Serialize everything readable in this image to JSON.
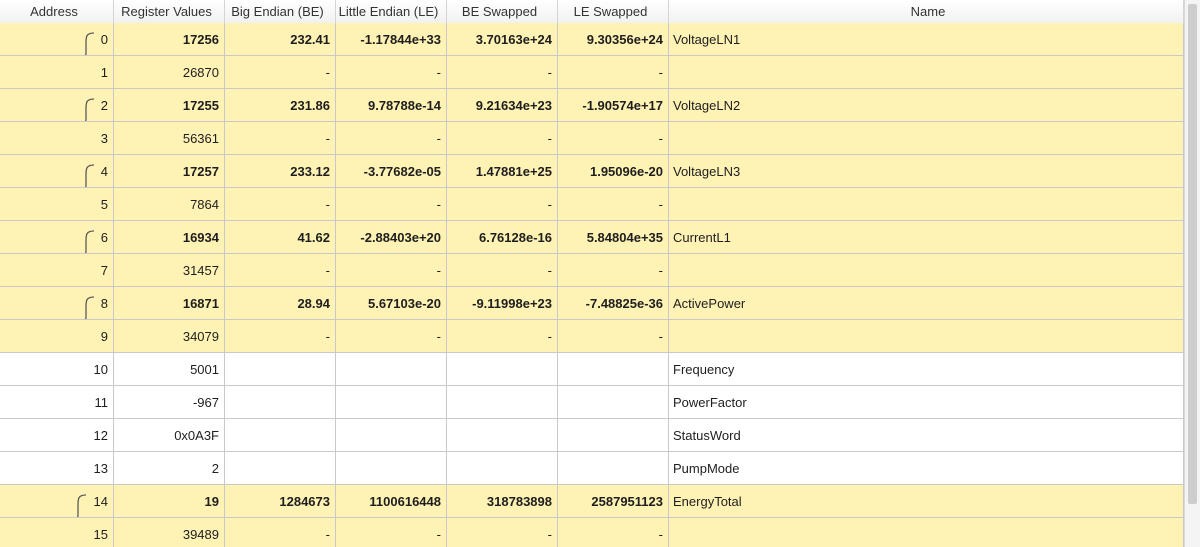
{
  "columns": {
    "address": "Address",
    "register_values": "Register Values",
    "big_endian": "Big Endian (BE)",
    "little_endian": "Little Endian (LE)",
    "be_swapped": "BE Swapped",
    "le_swapped": "LE Swapped",
    "name": "Name"
  },
  "rows": [
    {
      "address": "0",
      "reg": "17256",
      "be": "232.41",
      "le": "-1.17844e+33",
      "bes": "3.70163e+24",
      "les": "9.30356e+24",
      "name": "VoltageLN1"
    },
    {
      "address": "1",
      "reg": "26870",
      "be": "-",
      "le": "-",
      "bes": "-",
      "les": "-",
      "name": ""
    },
    {
      "address": "2",
      "reg": "17255",
      "be": "231.86",
      "le": "9.78788e-14",
      "bes": "9.21634e+23",
      "les": "-1.90574e+17",
      "name": "VoltageLN2"
    },
    {
      "address": "3",
      "reg": "56361",
      "be": "-",
      "le": "-",
      "bes": "-",
      "les": "-",
      "name": ""
    },
    {
      "address": "4",
      "reg": "17257",
      "be": "233.12",
      "le": "-3.77682e-05",
      "bes": "1.47881e+25",
      "les": "1.95096e-20",
      "name": "VoltageLN3"
    },
    {
      "address": "5",
      "reg": "7864",
      "be": "-",
      "le": "-",
      "bes": "-",
      "les": "-",
      "name": ""
    },
    {
      "address": "6",
      "reg": "16934",
      "be": "41.62",
      "le": "-2.88403e+20",
      "bes": "6.76128e-16",
      "les": "5.84804e+35",
      "name": "CurrentL1"
    },
    {
      "address": "7",
      "reg": "31457",
      "be": "-",
      "le": "-",
      "bes": "-",
      "les": "-",
      "name": ""
    },
    {
      "address": "8",
      "reg": "16871",
      "be": "28.94",
      "le": "5.67103e-20",
      "bes": "-9.11998e+23",
      "les": "-7.48825e-36",
      "name": "ActivePower"
    },
    {
      "address": "9",
      "reg": "34079",
      "be": "-",
      "le": "-",
      "bes": "-",
      "les": "-",
      "name": ""
    },
    {
      "address": "10",
      "reg": "5001",
      "be": "",
      "le": "",
      "bes": "",
      "les": "",
      "name": "Frequency"
    },
    {
      "address": "11",
      "reg": "-967",
      "be": "",
      "le": "",
      "bes": "",
      "les": "",
      "name": "PowerFactor"
    },
    {
      "address": "12",
      "reg": "0x0A3F",
      "be": "",
      "le": "",
      "bes": "",
      "les": "",
      "name": "StatusWord"
    },
    {
      "address": "13",
      "reg": "2",
      "be": "",
      "le": "",
      "bes": "",
      "les": "",
      "name": "PumpMode"
    },
    {
      "address": "14",
      "reg": "19",
      "be": "1284673",
      "le": "1100616448",
      "bes": "318783898",
      "les": "2587951123",
      "name": "EnergyTotal"
    },
    {
      "address": "15",
      "reg": "39489",
      "be": "-",
      "le": "-",
      "bes": "-",
      "les": "-",
      "name": ""
    }
  ],
  "colors": {
    "highlight": "#fff2b5",
    "grid_line": "#c9c9c9"
  },
  "icons": {
    "brace": "curly-brace-icon"
  }
}
